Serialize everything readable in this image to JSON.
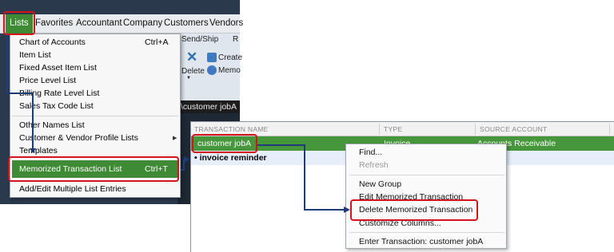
{
  "menubar": {
    "items": [
      "Lists",
      "Favorites",
      "Accountant",
      "Company",
      "Customers",
      "Vendors"
    ]
  },
  "ribbon": {
    "send_ship": "Send/Ship",
    "r_label": "R",
    "delete_label": "Delete",
    "create_label": "Create",
    "memo_label": "Memo"
  },
  "filter_text": "\\customer jobA",
  "lists_menu": {
    "items": [
      {
        "label": "Chart of Accounts",
        "shortcut": "Ctrl+A"
      },
      {
        "label": "Item List",
        "shortcut": ""
      },
      {
        "label": "Fixed Asset Item List",
        "shortcut": ""
      },
      {
        "label": "Price Level List",
        "shortcut": ""
      },
      {
        "label": "Billing Rate Level List",
        "shortcut": ""
      },
      {
        "label": "Sales Tax Code List",
        "shortcut": ""
      },
      {
        "label": "Other Names List",
        "shortcut": ""
      },
      {
        "label": "Customer & Vendor Profile Lists",
        "shortcut": ""
      },
      {
        "label": "Templates",
        "shortcut": ""
      },
      {
        "label": "Memorized Transaction List",
        "shortcut": "Ctrl+T"
      },
      {
        "label": "Add/Edit Multiple List Entries",
        "shortcut": ""
      }
    ]
  },
  "memorized_list": {
    "columns": [
      "TRANSACTION NAME",
      "TYPE",
      "SOURCE ACCOUNT"
    ],
    "rows": [
      {
        "name": "customer jobA",
        "type": "Invoice",
        "account": "Accounts Receivable"
      },
      {
        "name": "invoice reminder",
        "type": "",
        "account": ""
      }
    ]
  },
  "context_menu": {
    "items": [
      {
        "label": "Find...",
        "enabled": true
      },
      {
        "label": "Refresh",
        "enabled": false
      },
      {
        "label": "New Group",
        "enabled": true
      },
      {
        "label": "Edit Memorized Transaction",
        "enabled": true
      },
      {
        "label": "Delete Memorized Transaction",
        "enabled": true
      },
      {
        "label": "Customize Columns...",
        "enabled": true
      },
      {
        "label": "Enter Transaction: customer jobA",
        "enabled": true
      }
    ]
  },
  "colors": {
    "highlight_green": "#3f8a34",
    "callout_red": "#d3141b",
    "connector_navy": "#1e3c78"
  }
}
